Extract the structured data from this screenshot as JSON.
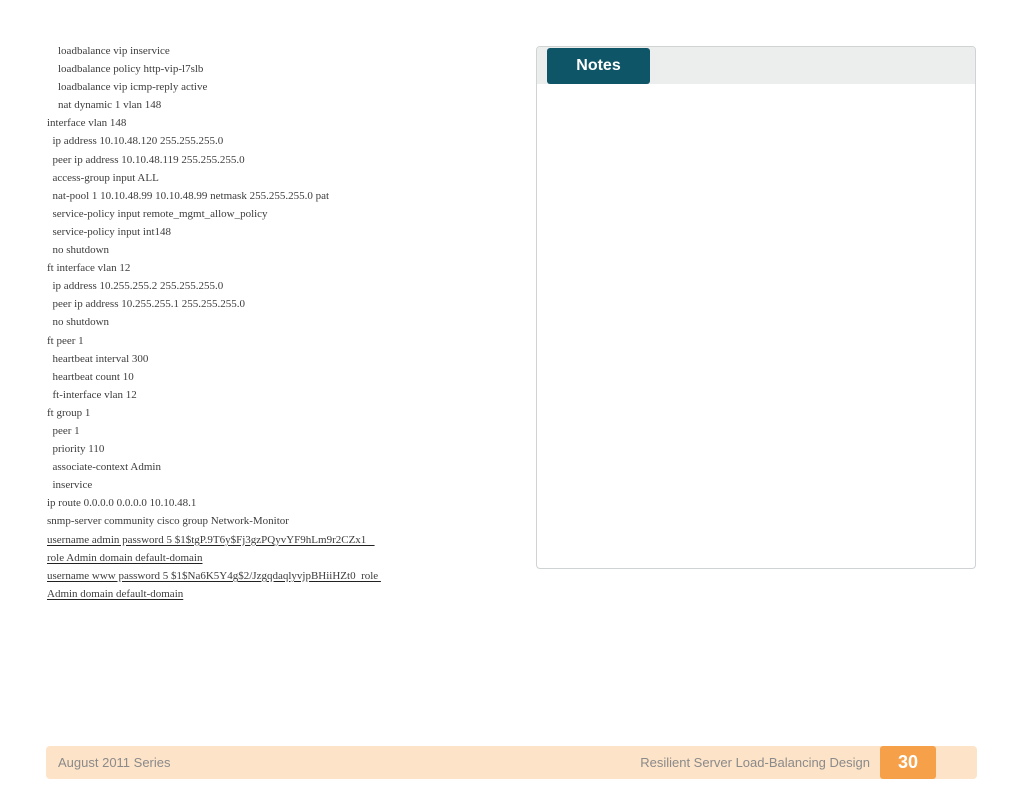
{
  "code_lines": [
    {
      "text": "    loadbalance vip inservice",
      "underline": false
    },
    {
      "text": "    loadbalance policy http-vip-l7slb",
      "underline": false
    },
    {
      "text": "    loadbalance vip icmp-reply active",
      "underline": false
    },
    {
      "text": "    nat dynamic 1 vlan 148",
      "underline": false
    },
    {
      "text": "interface vlan 148",
      "underline": false
    },
    {
      "text": "  ip address 10.10.48.120 255.255.255.0",
      "underline": false
    },
    {
      "text": "  peer ip address 10.10.48.119 255.255.255.0",
      "underline": false
    },
    {
      "text": "  access-group input ALL",
      "underline": false
    },
    {
      "text": "  nat-pool 1 10.10.48.99 10.10.48.99 netmask 255.255.255.0 pat",
      "underline": false
    },
    {
      "text": "  service-policy input remote_mgmt_allow_policy",
      "underline": false
    },
    {
      "text": "  service-policy input int148",
      "underline": false
    },
    {
      "text": "  no shutdown",
      "underline": false
    },
    {
      "text": "ft interface vlan 12",
      "underline": false
    },
    {
      "text": "  ip address 10.255.255.2 255.255.255.0",
      "underline": false
    },
    {
      "text": "  peer ip address 10.255.255.1 255.255.255.0",
      "underline": false
    },
    {
      "text": "  no shutdown",
      "underline": false
    },
    {
      "text": "ft peer 1",
      "underline": false
    },
    {
      "text": "  heartbeat interval 300",
      "underline": false
    },
    {
      "text": "  heartbeat count 10",
      "underline": false
    },
    {
      "text": "  ft-interface vlan 12",
      "underline": false
    },
    {
      "text": "ft group 1",
      "underline": false
    },
    {
      "text": "  peer 1",
      "underline": false
    },
    {
      "text": "  priority 110",
      "underline": false
    },
    {
      "text": "  associate-context Admin",
      "underline": false
    },
    {
      "text": "  inservice",
      "underline": false
    },
    {
      "text": "ip route 0.0.0.0 0.0.0.0 10.10.48.1",
      "underline": false
    },
    {
      "text": "snmp-server community cisco group Network-Monitor",
      "underline": false
    },
    {
      "text": "username admin password 5 $1$tgP.9T6y$Fj3gzPQyvYF9hLm9r2CZx1   ",
      "underline": true
    },
    {
      "text": "role Admin domain default-domain",
      "underline": true
    },
    {
      "text": "username www password 5 $1$Na6K5Y4g$2/JzgqdaqlyvjpBHiiHZt0  role ",
      "underline": true
    },
    {
      "text": "Admin domain default-domain",
      "underline": true
    }
  ],
  "notes": {
    "title": "Notes"
  },
  "footer": {
    "series": "August 2011 Series",
    "doc_title": "Resilient Server Load-Balancing Design",
    "page_number": "30"
  },
  "colors": {
    "notes_tab": "#0e5567",
    "footer_bg": "#fde3c8",
    "page_badge": "#f6a14a"
  }
}
